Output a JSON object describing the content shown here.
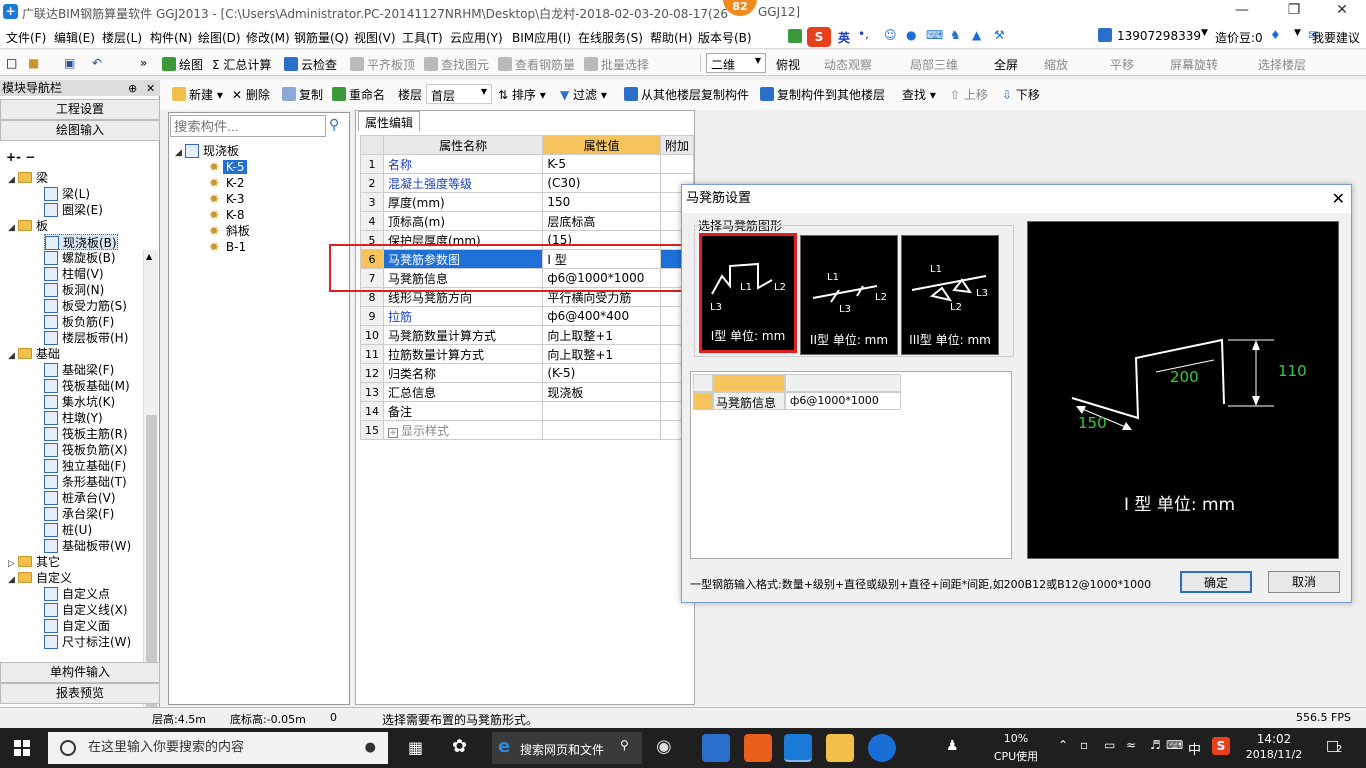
{
  "window": {
    "title": "广联达BIM钢筋算量软件 GGJ2013 - [C:\\Users\\Administrator.PC-20141127NRHM\\Desktop\\白龙村-2018-02-03-20-08-17(26",
    "title_tail": "GGJ12]",
    "badge": "82"
  },
  "menu": [
    "文件(F)",
    "编辑(E)",
    "楼层(L)",
    "构件(N)",
    "绘图(D)",
    "修改(M)",
    "钢筋量(Q)",
    "视图(V)",
    "工具(T)",
    "云应用(Y)",
    "BIM应用(I)",
    "在线服务(S)",
    "帮助(H)",
    "版本号(B)"
  ],
  "menu_right": {
    "phone": "13907298339",
    "price": "造价豆:0",
    "suggest": "我要建议",
    "ime": "英"
  },
  "toolbar": {
    "draw": "绘图",
    "sum": "汇总计算",
    "cloud": "云检查",
    "flat": "平齐板顶",
    "find": "查找图元",
    "view_qty": "查看钢筋量",
    "batch": "批量选择",
    "view_mode": "二维",
    "overlook": "俯视",
    "dynamic": "动态观察",
    "local3d": "局部三维",
    "fullscreen": "全屏",
    "zoom": "缩放",
    "pan": "平移",
    "rotate": "屏幕旋转",
    "select_layer": "选择楼层"
  },
  "sidebar": {
    "title": "模块导航栏",
    "project": "工程设置",
    "draw_input": "绘图输入",
    "single_input": "单构件输入",
    "report": "报表预览",
    "groups": [
      {
        "label": "梁",
        "items": [
          "梁(L)",
          "圈梁(E)"
        ]
      },
      {
        "label": "板",
        "items": [
          "现浇板(B)",
          "螺旋板(B)",
          "柱帽(V)",
          "板洞(N)",
          "板受力筋(S)",
          "板负筋(F)",
          "楼层板带(H)"
        ]
      },
      {
        "label": "基础",
        "items": [
          "基础梁(F)",
          "筏板基础(M)",
          "集水坑(K)",
          "柱墩(Y)",
          "筏板主筋(R)",
          "筏板负筋(X)",
          "独立基础(F)",
          "条形基础(T)",
          "桩承台(V)",
          "承台梁(F)",
          "桩(U)",
          "基础板带(W)"
        ]
      },
      {
        "label": "其它",
        "items": []
      },
      {
        "label": "自定义",
        "items": [
          "自定义点",
          "自定义线(X)",
          "自定义面",
          "尺寸标注(W)"
        ]
      }
    ]
  },
  "component_bar": {
    "new": "新建",
    "delete": "删除",
    "copy": "复制",
    "rename": "重命名",
    "floor_label": "楼层",
    "floor_value": "首层",
    "sort": "排序",
    "filter": "过滤",
    "copy_from": "从其他楼层复制构件",
    "copy_to": "复制构件到其他楼层",
    "find": "查找",
    "up": "上移",
    "down": "下移"
  },
  "component_list": {
    "search_placeholder": "搜索构件...",
    "root": "现浇板",
    "items": [
      "K-5",
      "K-2",
      "K-3",
      "K-8",
      "斜板",
      "B-1"
    ],
    "selected": "K-5"
  },
  "properties": {
    "tab": "属性编辑",
    "col_name": "属性名称",
    "col_value": "属性值",
    "col_extra": "附加",
    "rows": [
      {
        "n": "1",
        "name": "名称",
        "value": "K-5",
        "blue": true
      },
      {
        "n": "2",
        "name": "混凝土强度等级",
        "value": "(C30)",
        "blue": true
      },
      {
        "n": "3",
        "name": "厚度(mm)",
        "value": "150",
        "blue": false
      },
      {
        "n": "4",
        "name": "顶标高(m)",
        "value": "层底标高",
        "blue": false
      },
      {
        "n": "5",
        "name": "保护层厚度(mm)",
        "value": "(15)",
        "blue": false
      },
      {
        "n": "6",
        "name": "马凳筋参数图",
        "value": "I 型",
        "blue": false,
        "selected": true
      },
      {
        "n": "7",
        "name": "马凳筋信息",
        "value": "ф6@1000*1000",
        "blue": false
      },
      {
        "n": "8",
        "name": "线形马凳筋方向",
        "value": "平行横向受力筋",
        "blue": false
      },
      {
        "n": "9",
        "name": "拉筋",
        "value": "ф6@400*400",
        "blue": true
      },
      {
        "n": "10",
        "name": "马凳筋数量计算方式",
        "value": "向上取整+1",
        "blue": false
      },
      {
        "n": "11",
        "name": "拉筋数量计算方式",
        "value": "向上取整+1",
        "blue": false
      },
      {
        "n": "12",
        "name": "归类名称",
        "value": "(K-5)",
        "blue": false
      },
      {
        "n": "13",
        "name": "汇总信息",
        "value": "现浇板",
        "blue": false
      },
      {
        "n": "14",
        "name": "备注",
        "value": "",
        "blue": false
      },
      {
        "n": "15",
        "name": "显示样式",
        "value": "",
        "blue": false,
        "expand": true
      }
    ]
  },
  "dialog": {
    "title": "马凳筋设置",
    "choose_label": "选择马凳筋图形",
    "shapes": [
      {
        "label": "I型 单位: mm",
        "selected": true
      },
      {
        "label": "II型 单位: mm",
        "selected": false
      },
      {
        "label": "III型 单位: mm",
        "selected": false
      }
    ],
    "info_name": "马凳筋信息",
    "info_value": "ф6@1000*1000",
    "preview": {
      "d200": "200",
      "d110": "110",
      "d150": "150",
      "caption": "I 型 单位: mm"
    },
    "hint": "一型钢筋输入格式:数量+级别+直径或级别+直径+间距*间距,如200B12或B12@1000*1000",
    "ok": "确定",
    "cancel": "取消"
  },
  "status": {
    "floor_h": "层高:4.5m",
    "bottom": "底标高:-0.05m",
    "zero": "0",
    "msg": "选择需要布置的马凳筋形式。",
    "fps": "556.5 FPS"
  },
  "taskbar": {
    "search": "在这里输入你要搜索的内容",
    "web": "搜索网页和文件",
    "cpu_pct": "10%",
    "cpu_label": "CPU使用",
    "lang": "中",
    "time": "14:02",
    "date": "2018/11/2",
    "notif": "2"
  },
  "colors": {
    "accent": "#1e6fd6",
    "red": "#e02020",
    "header": "#f7c35c",
    "preview_green": "#33cc33"
  }
}
